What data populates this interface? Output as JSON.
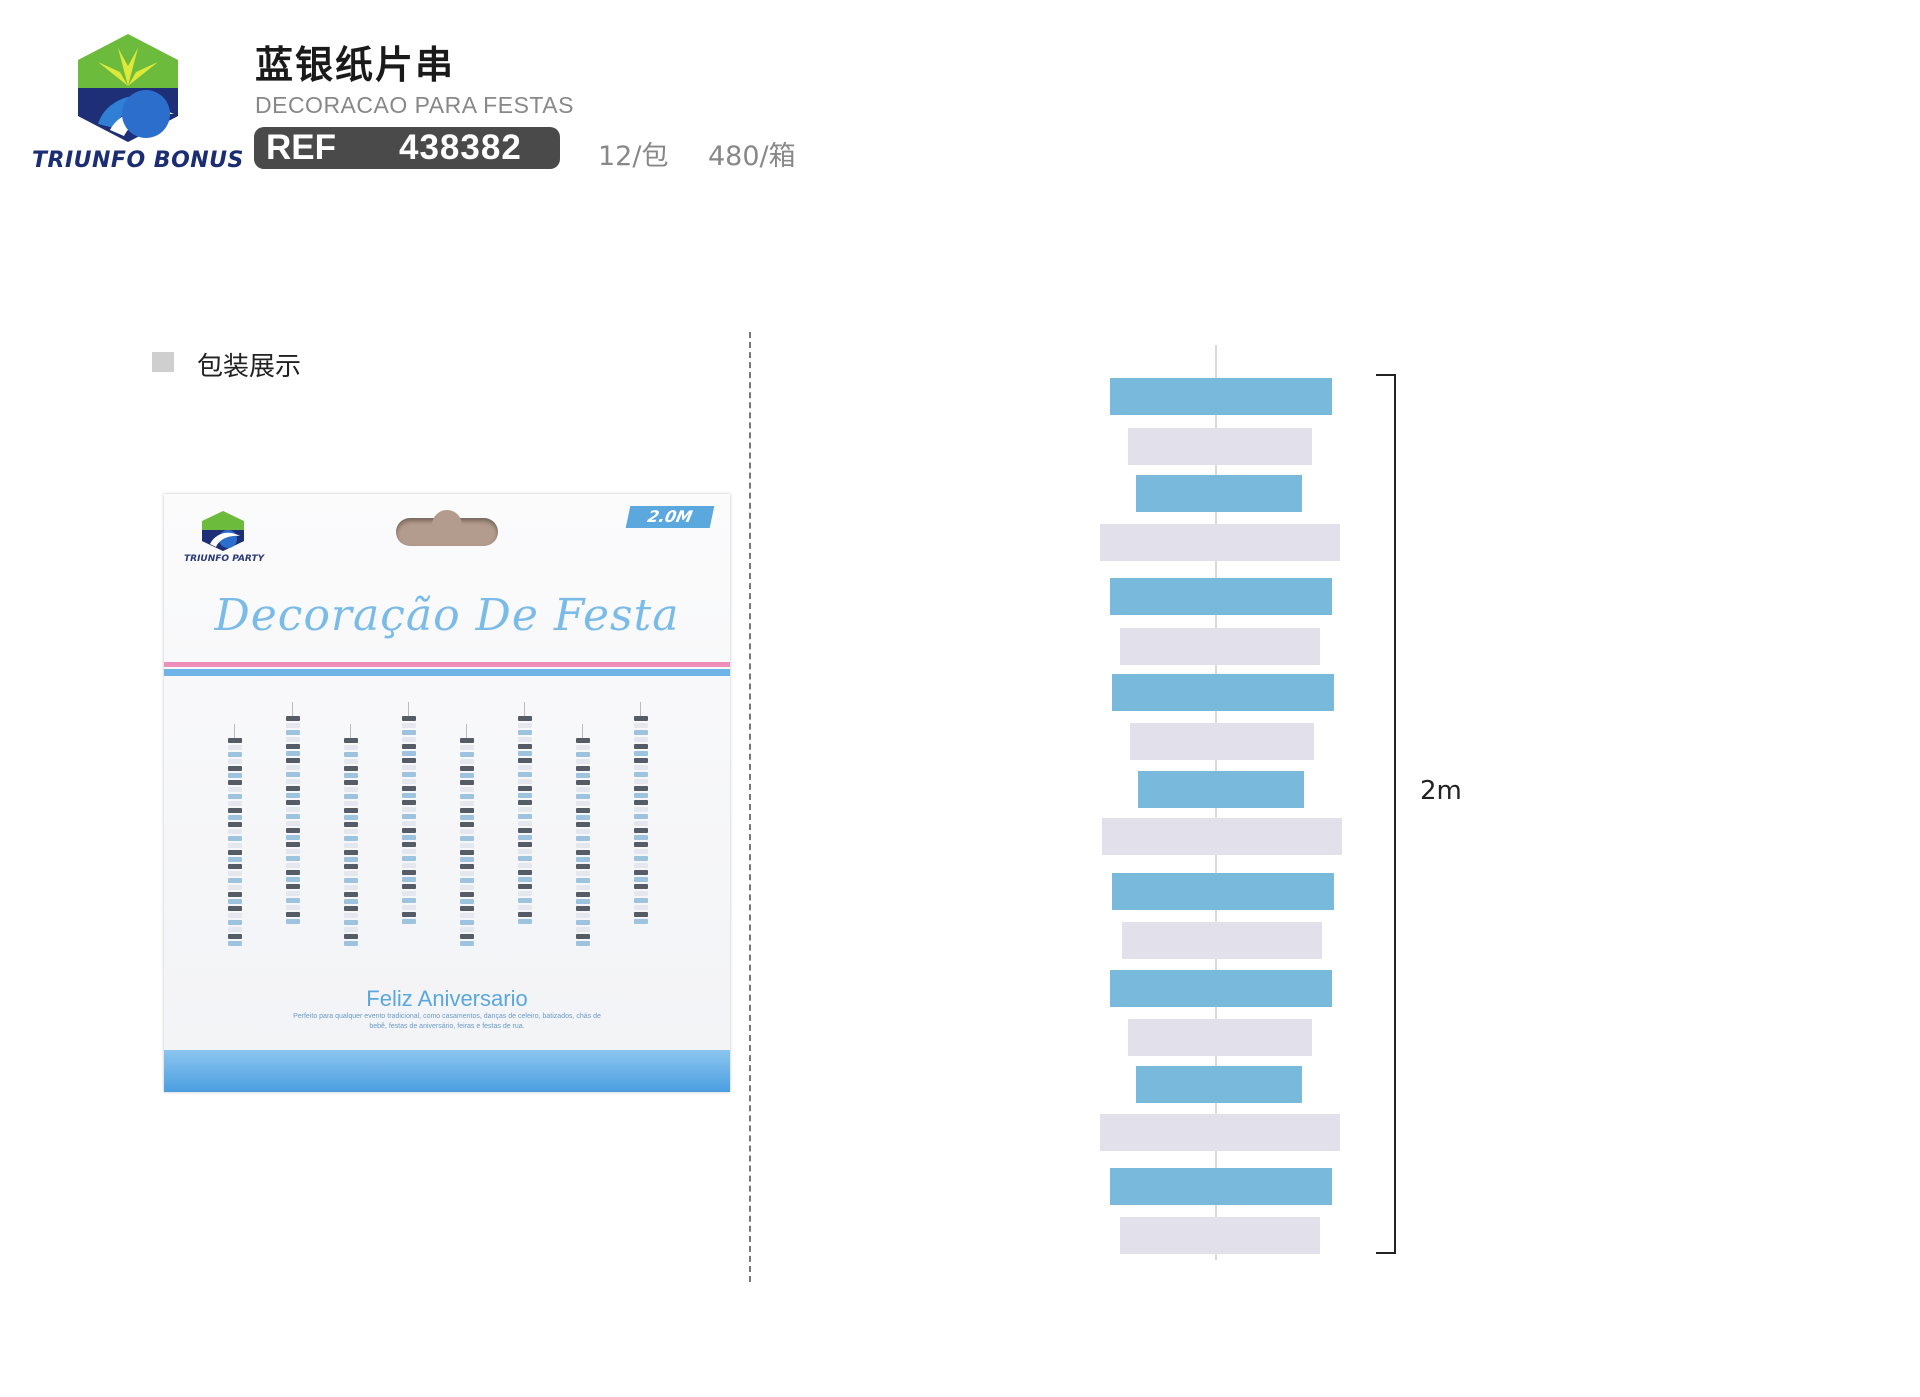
{
  "header": {
    "brand": "TRIUNFO BONUS",
    "title": "蓝银纸片串",
    "subtitle": "DECORACAO PARA FESTAS",
    "ref_label": "REF",
    "ref_number": "438382",
    "pack_qty": "12/包",
    "box_qty": "480/箱"
  },
  "section": {
    "label": "包装展示"
  },
  "package": {
    "brand": "TRIUNFO PARTY",
    "length_badge": "2.0M",
    "script_title": "Decoração De Festa",
    "subtitle": "Feliz Aniversario",
    "description": "Perfeito para qualquer evento tradicional, como casamentos, danças de celeiro, batizados, chás de bebê, festas de aniversário, feiras e festas de rua."
  },
  "dimension": {
    "length_label": "2m"
  },
  "colors": {
    "strip_blue": "#78b9dc",
    "strip_silver": "#e2e0ea",
    "brand_navy": "#1b2e73",
    "badge_gray": "#4a4a4a"
  }
}
